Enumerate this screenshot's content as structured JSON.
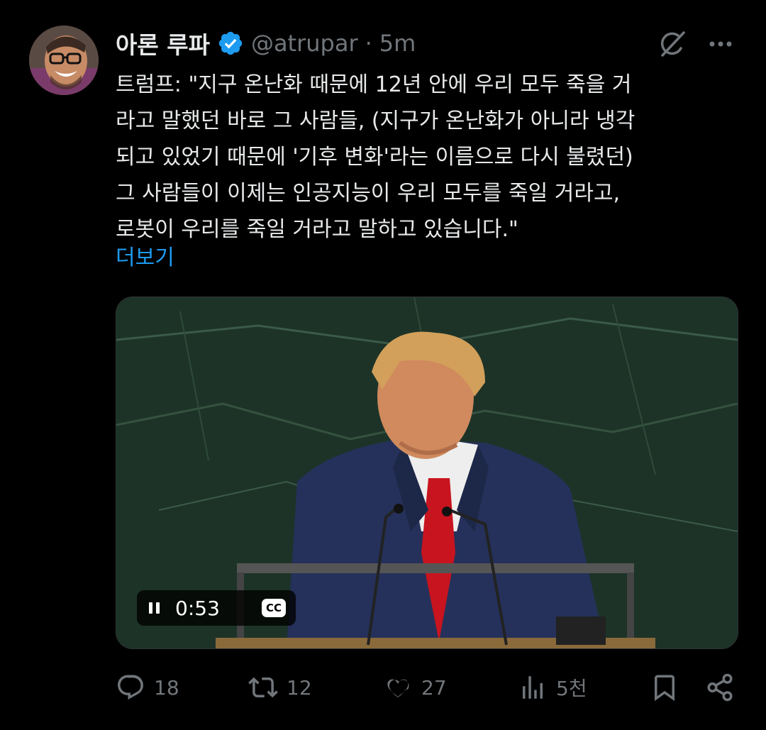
{
  "author": {
    "name": "아론 루파",
    "handle": "@atrupar",
    "separator": "·",
    "time": "5m",
    "verified": true
  },
  "tweet": {
    "text": "트럼프: \"지구 온난화 때문에 12년 안에 우리 모두 죽을 거\n라고 말했던 바로 그 사람들, (지구가 온난화가 아니라 냉각\n되고 있었기 때문에 '기후 변화'라는 이름으로 다시 불렸던)\n그 사람들이 이제는 인공지능이 우리 모두를 죽일 거라고,\n로봇이 우리를 죽일 거라고 말하고 있습니다.\"",
    "show_more": "더보기"
  },
  "video": {
    "duration": "0:53",
    "cc_label": "CC",
    "playing": true
  },
  "actions": {
    "replies": "18",
    "reposts": "12",
    "likes": "27",
    "views": "5천"
  },
  "colors": {
    "accent": "#1d9bf0",
    "text": "#e7e9ea",
    "muted": "#71767b",
    "background": "#000000"
  }
}
